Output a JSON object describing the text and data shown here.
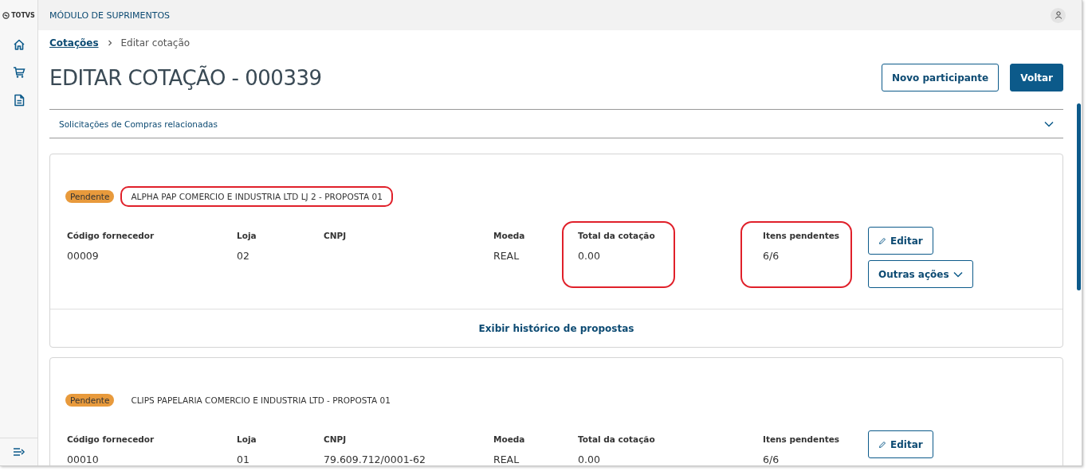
{
  "app": {
    "logo": "TOTVS",
    "title": "MÓDULO DE SUPRIMENTOS"
  },
  "sidebar": {
    "items": [
      {
        "kind": "home"
      },
      {
        "kind": "cart"
      },
      {
        "kind": "document"
      }
    ],
    "collapse": {
      "kind": "expand"
    }
  },
  "breadcrumb": [
    {
      "label": "Cotações",
      "link": true
    },
    {
      "label": "Editar cotação",
      "link": false
    }
  ],
  "page_title": "EDITAR COTAÇÃO - 000339",
  "actions": [
    {
      "label": "Novo participante",
      "primary": false
    },
    {
      "label": "Voltar",
      "primary": true
    }
  ],
  "accordion": {
    "label": "Solicitações de Compras relacionadas",
    "expanded": false
  },
  "proposals": [
    {
      "status": "Pendente",
      "name": "ALPHA PAP COMERCIO E INDUSTRIA LTD LJ 2 - PROPOSTA 01",
      "highlighted": true,
      "fields": [
        {
          "label": "Código fornecedor",
          "value": "00009",
          "highlighted": false
        },
        {
          "label": "Loja",
          "value": "02",
          "highlighted": false
        },
        {
          "label": "CNPJ",
          "highlighted": false
        },
        {
          "label": "Moeda",
          "value": "REAL",
          "highlighted": false
        },
        {
          "label": "Total da cotação",
          "value": "0.00",
          "highlighted": true
        },
        {
          "label": "Itens pendentes",
          "value": "6/6",
          "highlighted": true
        }
      ],
      "buttons": [
        {
          "label": "Editar",
          "kind": "edit"
        },
        {
          "label": "Outras ações",
          "kind": "menu"
        }
      ],
      "footer_link": "Exibir histórico de propostas"
    },
    {
      "status": "Pendente",
      "name": "CLIPS PAPELARIA COMERCIO E INDUSTRIA LTD - PROPOSTA 01",
      "highlighted": false,
      "fields": [
        {
          "label": "Código fornecedor",
          "value": "00010",
          "highlighted": false
        },
        {
          "label": "Loja",
          "value": "01",
          "highlighted": false
        },
        {
          "label": "CNPJ",
          "value": "79.609.712/0001-62",
          "highlighted": false
        },
        {
          "label": "Moeda",
          "value": "REAL",
          "highlighted": false
        },
        {
          "label": "Total da cotação",
          "value": "0.00",
          "highlighted": false
        },
        {
          "label": "Itens pendentes",
          "value": "6/6",
          "highlighted": false
        }
      ],
      "buttons": [
        {
          "label": "Editar",
          "kind": "edit"
        }
      ]
    }
  ]
}
